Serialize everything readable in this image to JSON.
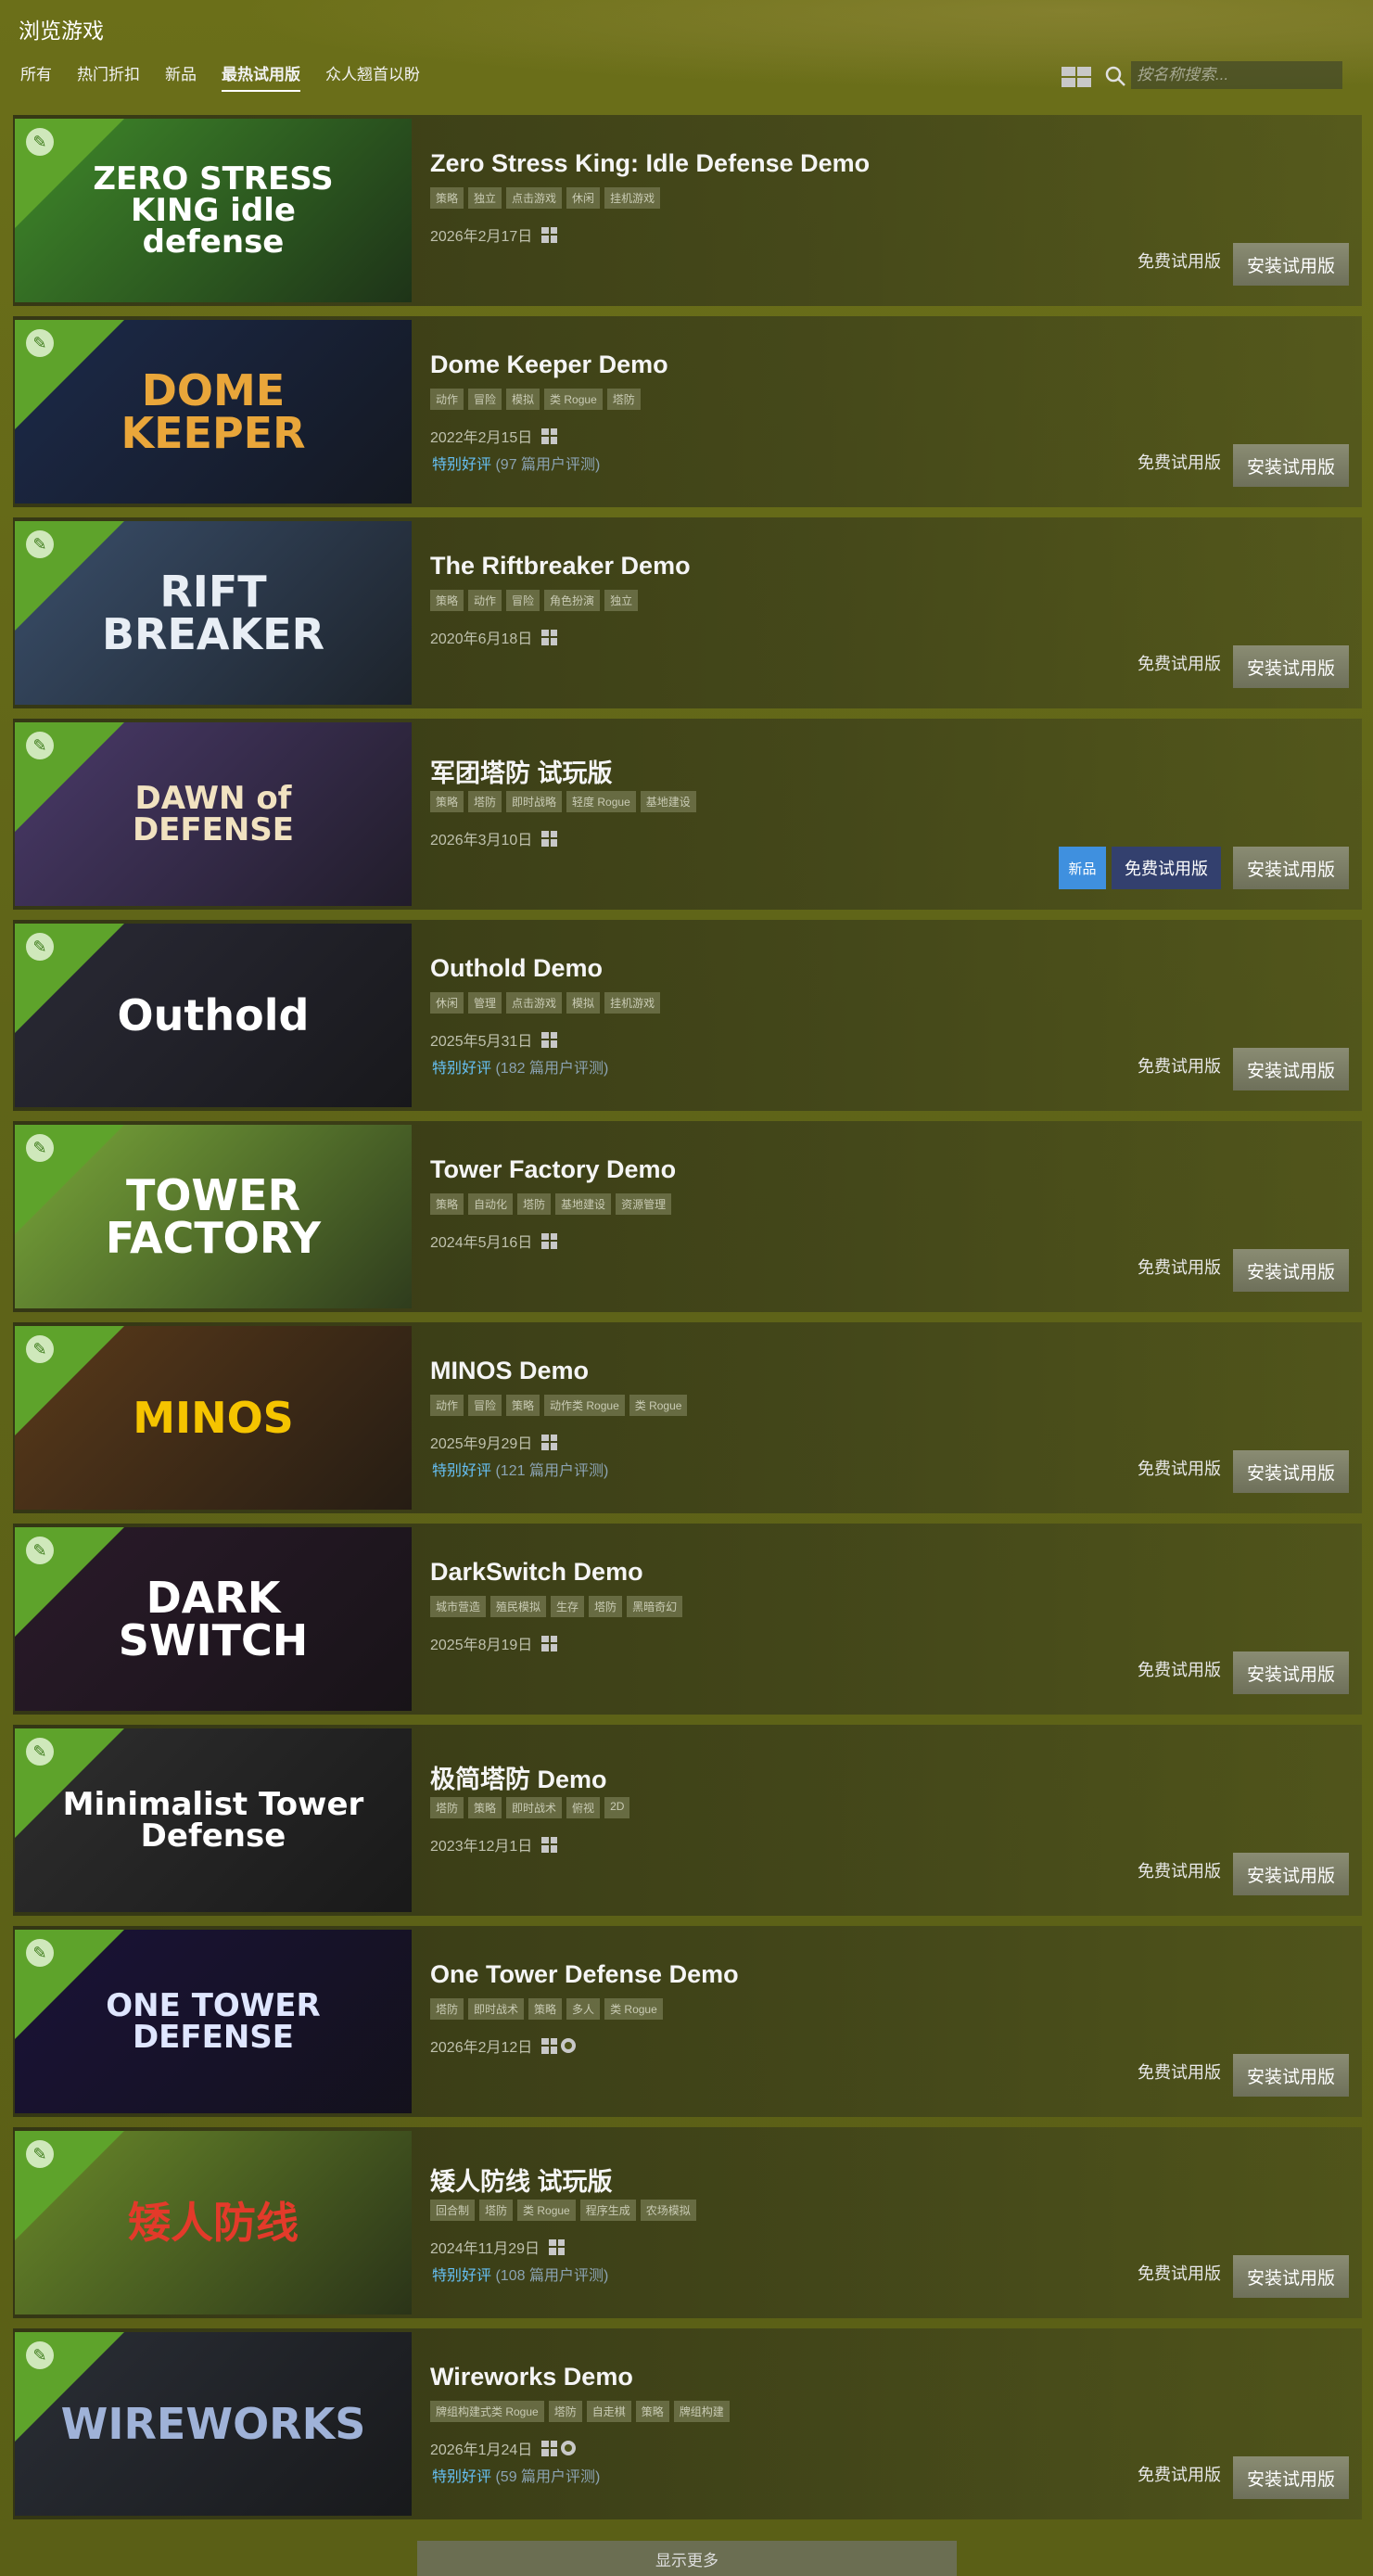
{
  "header": {
    "title": "浏览游戏",
    "tabs": [
      {
        "label": "所有",
        "active": false
      },
      {
        "label": "热门折扣",
        "active": false
      },
      {
        "label": "新品",
        "active": false
      },
      {
        "label": "最热试用版",
        "active": true
      },
      {
        "label": "众人翘首以盼",
        "active": false
      }
    ],
    "view_toggle_icon": "grid-icon",
    "search_icon": "search-icon",
    "search_placeholder": "按名称搜索..."
  },
  "colors": {
    "review_positive": "#66c0f4",
    "new_badge": "#3f90df",
    "demo_corner": "#5ea32b"
  },
  "games": [
    {
      "title": "Zero Stress King: Idle Defense Demo",
      "tags": [
        "策略",
        "独立",
        "点击游戏",
        "休闲",
        "挂机游戏"
      ],
      "date": "2026年2月17日",
      "platforms": [
        "windows"
      ],
      "review_label": "",
      "review_count": "",
      "is_new": false,
      "free_label": "免费试用版",
      "install_label": "安装试用版",
      "capsule_text": "ZERO STRESS KING idle defense",
      "capsule_bg": "#3f8a2a",
      "capsule_fg": "#ffffff"
    },
    {
      "title": "Dome Keeper Demo",
      "tags": [
        "动作",
        "冒险",
        "模拟",
        "类 Rogue",
        "塔防"
      ],
      "date": "2022年2月15日",
      "platforms": [
        "windows"
      ],
      "review_label": "特别好评",
      "review_count": "(97 篇用户评测)",
      "is_new": false,
      "free_label": "免费试用版",
      "install_label": "安装试用版",
      "capsule_text": "DOME KEEPER",
      "capsule_bg": "#1c2a4a",
      "capsule_fg": "#e9a63a"
    },
    {
      "title": "The Riftbreaker Demo",
      "tags": [
        "策略",
        "动作",
        "冒险",
        "角色扮演",
        "独立"
      ],
      "date": "2020年6月18日",
      "platforms": [
        "windows"
      ],
      "review_label": "",
      "review_count": "",
      "is_new": false,
      "free_label": "免费试用版",
      "install_label": "安装试用版",
      "capsule_text": "RIFT BREAKER",
      "capsule_bg": "#3a4f6b",
      "capsule_fg": "#e8eef5"
    },
    {
      "title": "军团塔防 试玩版",
      "tags": [
        "策略",
        "塔防",
        "即时战略",
        "轻度 Rogue",
        "基地建设"
      ],
      "date": "2026年3月10日",
      "platforms": [
        "windows"
      ],
      "review_label": "",
      "review_count": "",
      "is_new": true,
      "new_label": "新品",
      "free_label": "免费试用版",
      "install_label": "安装试用版",
      "capsule_text": "DAWN of DEFENSE",
      "capsule_bg": "#4a3a6a",
      "capsule_fg": "#f1e2c0"
    },
    {
      "title": "Outhold Demo",
      "tags": [
        "休闲",
        "管理",
        "点击游戏",
        "模拟",
        "挂机游戏"
      ],
      "date": "2025年5月31日",
      "platforms": [
        "windows"
      ],
      "review_label": "特别好评",
      "review_count": "(182 篇用户评测)",
      "is_new": false,
      "free_label": "免费试用版",
      "install_label": "安装试用版",
      "capsule_text": "Outhold",
      "capsule_bg": "#2a2a36",
      "capsule_fg": "#ffffff"
    },
    {
      "title": "Tower Factory Demo",
      "tags": [
        "策略",
        "自动化",
        "塔防",
        "基地建设",
        "资源管理"
      ],
      "date": "2024年5月16日",
      "platforms": [
        "windows"
      ],
      "review_label": "",
      "review_count": "",
      "is_new": false,
      "free_label": "免费试用版",
      "install_label": "安装试用版",
      "capsule_text": "TOWER FACTORY",
      "capsule_bg": "#7aa83a",
      "capsule_fg": "#ffffff"
    },
    {
      "title": "MINOS Demo",
      "tags": [
        "动作",
        "冒险",
        "策略",
        "动作类 Rogue",
        "类 Rogue"
      ],
      "date": "2025年9月29日",
      "platforms": [
        "windows"
      ],
      "review_label": "特别好评",
      "review_count": "(121 篇用户评测)",
      "is_new": false,
      "free_label": "免费试用版",
      "install_label": "安装试用版",
      "capsule_text": "MINOS",
      "capsule_bg": "#5a3a1a",
      "capsule_fg": "#f5c400"
    },
    {
      "title": "DarkSwitch Demo",
      "tags": [
        "城市营造",
        "殖民模拟",
        "生存",
        "塔防",
        "黑暗奇幻"
      ],
      "date": "2025年8月19日",
      "platforms": [
        "windows"
      ],
      "review_label": "",
      "review_count": "",
      "is_new": false,
      "free_label": "免费试用版",
      "install_label": "安装试用版",
      "capsule_text": "DARK SWITCH",
      "capsule_bg": "#2a1a2a",
      "capsule_fg": "#ffffff"
    },
    {
      "title": "极简塔防 Demo",
      "tags": [
        "塔防",
        "策略",
        "即时战术",
        "俯视",
        "2D"
      ],
      "date": "2023年12月1日",
      "platforms": [
        "windows"
      ],
      "review_label": "",
      "review_count": "",
      "is_new": false,
      "free_label": "免费试用版",
      "install_label": "安装试用版",
      "capsule_text": "Minimalist Tower Defense",
      "capsule_bg": "#2e2e2e",
      "capsule_fg": "#ffffff"
    },
    {
      "title": "One Tower Defense Demo",
      "tags": [
        "塔防",
        "即时战术",
        "策略",
        "多人",
        "类 Rogue"
      ],
      "date": "2026年2月12日",
      "platforms": [
        "windows",
        "steam"
      ],
      "review_label": "",
      "review_count": "",
      "is_new": false,
      "free_label": "免费试用版",
      "install_label": "安装试用版",
      "capsule_text": "ONE TOWER DEFENSE",
      "capsule_bg": "#1a1238",
      "capsule_fg": "#dfe6ff"
    },
    {
      "title": "矮人防线 试玩版",
      "tags": [
        "回合制",
        "塔防",
        "类 Rogue",
        "程序生成",
        "农场模拟"
      ],
      "date": "2024年11月29日",
      "platforms": [
        "windows"
      ],
      "review_label": "特别好评",
      "review_count": "(108 篇用户评测)",
      "is_new": false,
      "free_label": "免费试用版",
      "install_label": "安装试用版",
      "capsule_text": "矮人防线",
      "capsule_bg": "#6a8a2a",
      "capsule_fg": "#e33a2a"
    },
    {
      "title": "Wireworks Demo",
      "tags": [
        "牌组构建式类 Rogue",
        "塔防",
        "自走棋",
        "策略",
        "牌组构建"
      ],
      "date": "2026年1月24日",
      "platforms": [
        "windows",
        "steam"
      ],
      "review_label": "特别好评",
      "review_count": "(59 篇用户评测)",
      "is_new": false,
      "free_label": "免费试用版",
      "install_label": "安装试用版",
      "capsule_text": "WIREWORKS",
      "capsule_bg": "#2a2e36",
      "capsule_fg": "#9fb2d8"
    }
  ],
  "show_more_label": "显示更多"
}
